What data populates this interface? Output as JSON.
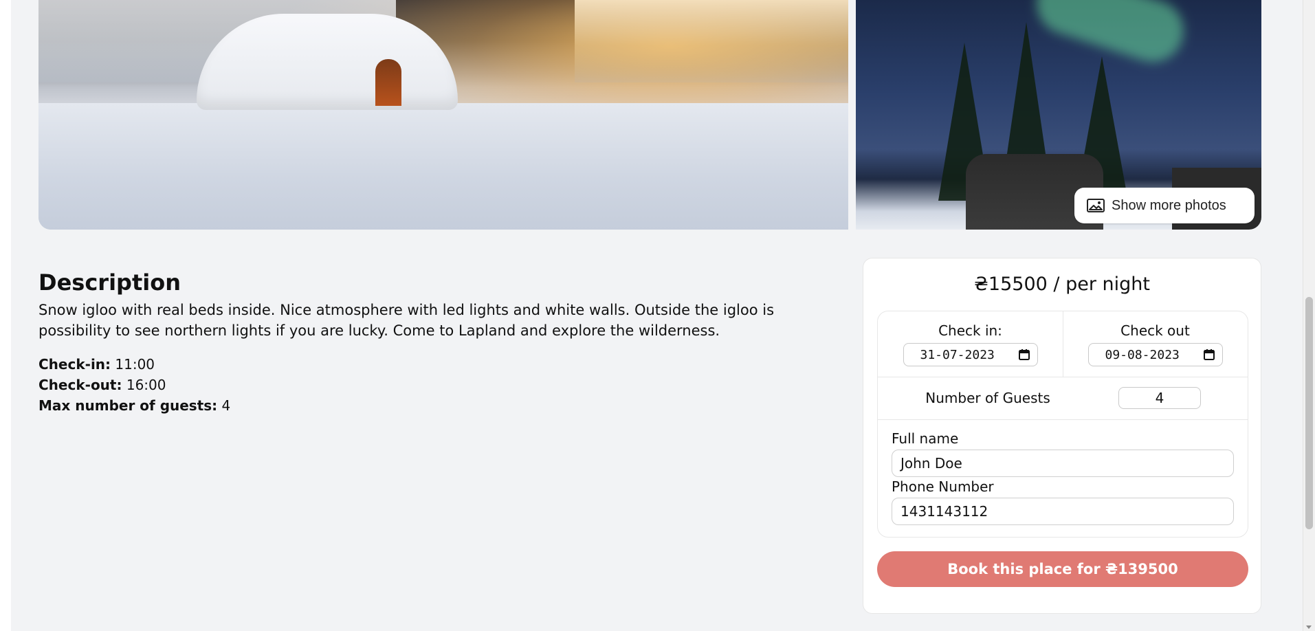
{
  "gallery": {
    "show_more_label": "Show more photos"
  },
  "description": {
    "title": "Description",
    "text": "Snow igloo with real beds inside. Nice atmosphere with led lights and white walls. Outside the igloo is possibility to see northern lights if you are lucky. Come to Lapland and explore the wilderness.",
    "checkin_label": "Check-in:",
    "checkin_value": "11:00",
    "checkout_label": "Check-out:",
    "checkout_value": "16:00",
    "maxguests_label": "Max number of guests:",
    "maxguests_value": "4"
  },
  "booking": {
    "price": "₴15500 / per night",
    "checkin_label": "Check in:",
    "checkin_value": "31-07-2023",
    "checkout_label": "Check out",
    "checkout_value": "09-08-2023",
    "guests_label": "Number of Guests",
    "guests_value": "4",
    "fullname_label": "Full name",
    "fullname_value": "John Doe",
    "phone_label": "Phone Number",
    "phone_value": "1431143112",
    "book_button": "Book this place for ₴139500"
  },
  "colors": {
    "page_bg": "#f2f3f5",
    "book_button_bg": "#e07a73"
  },
  "icons": [
    "image-icon",
    "calendar-icon"
  ]
}
